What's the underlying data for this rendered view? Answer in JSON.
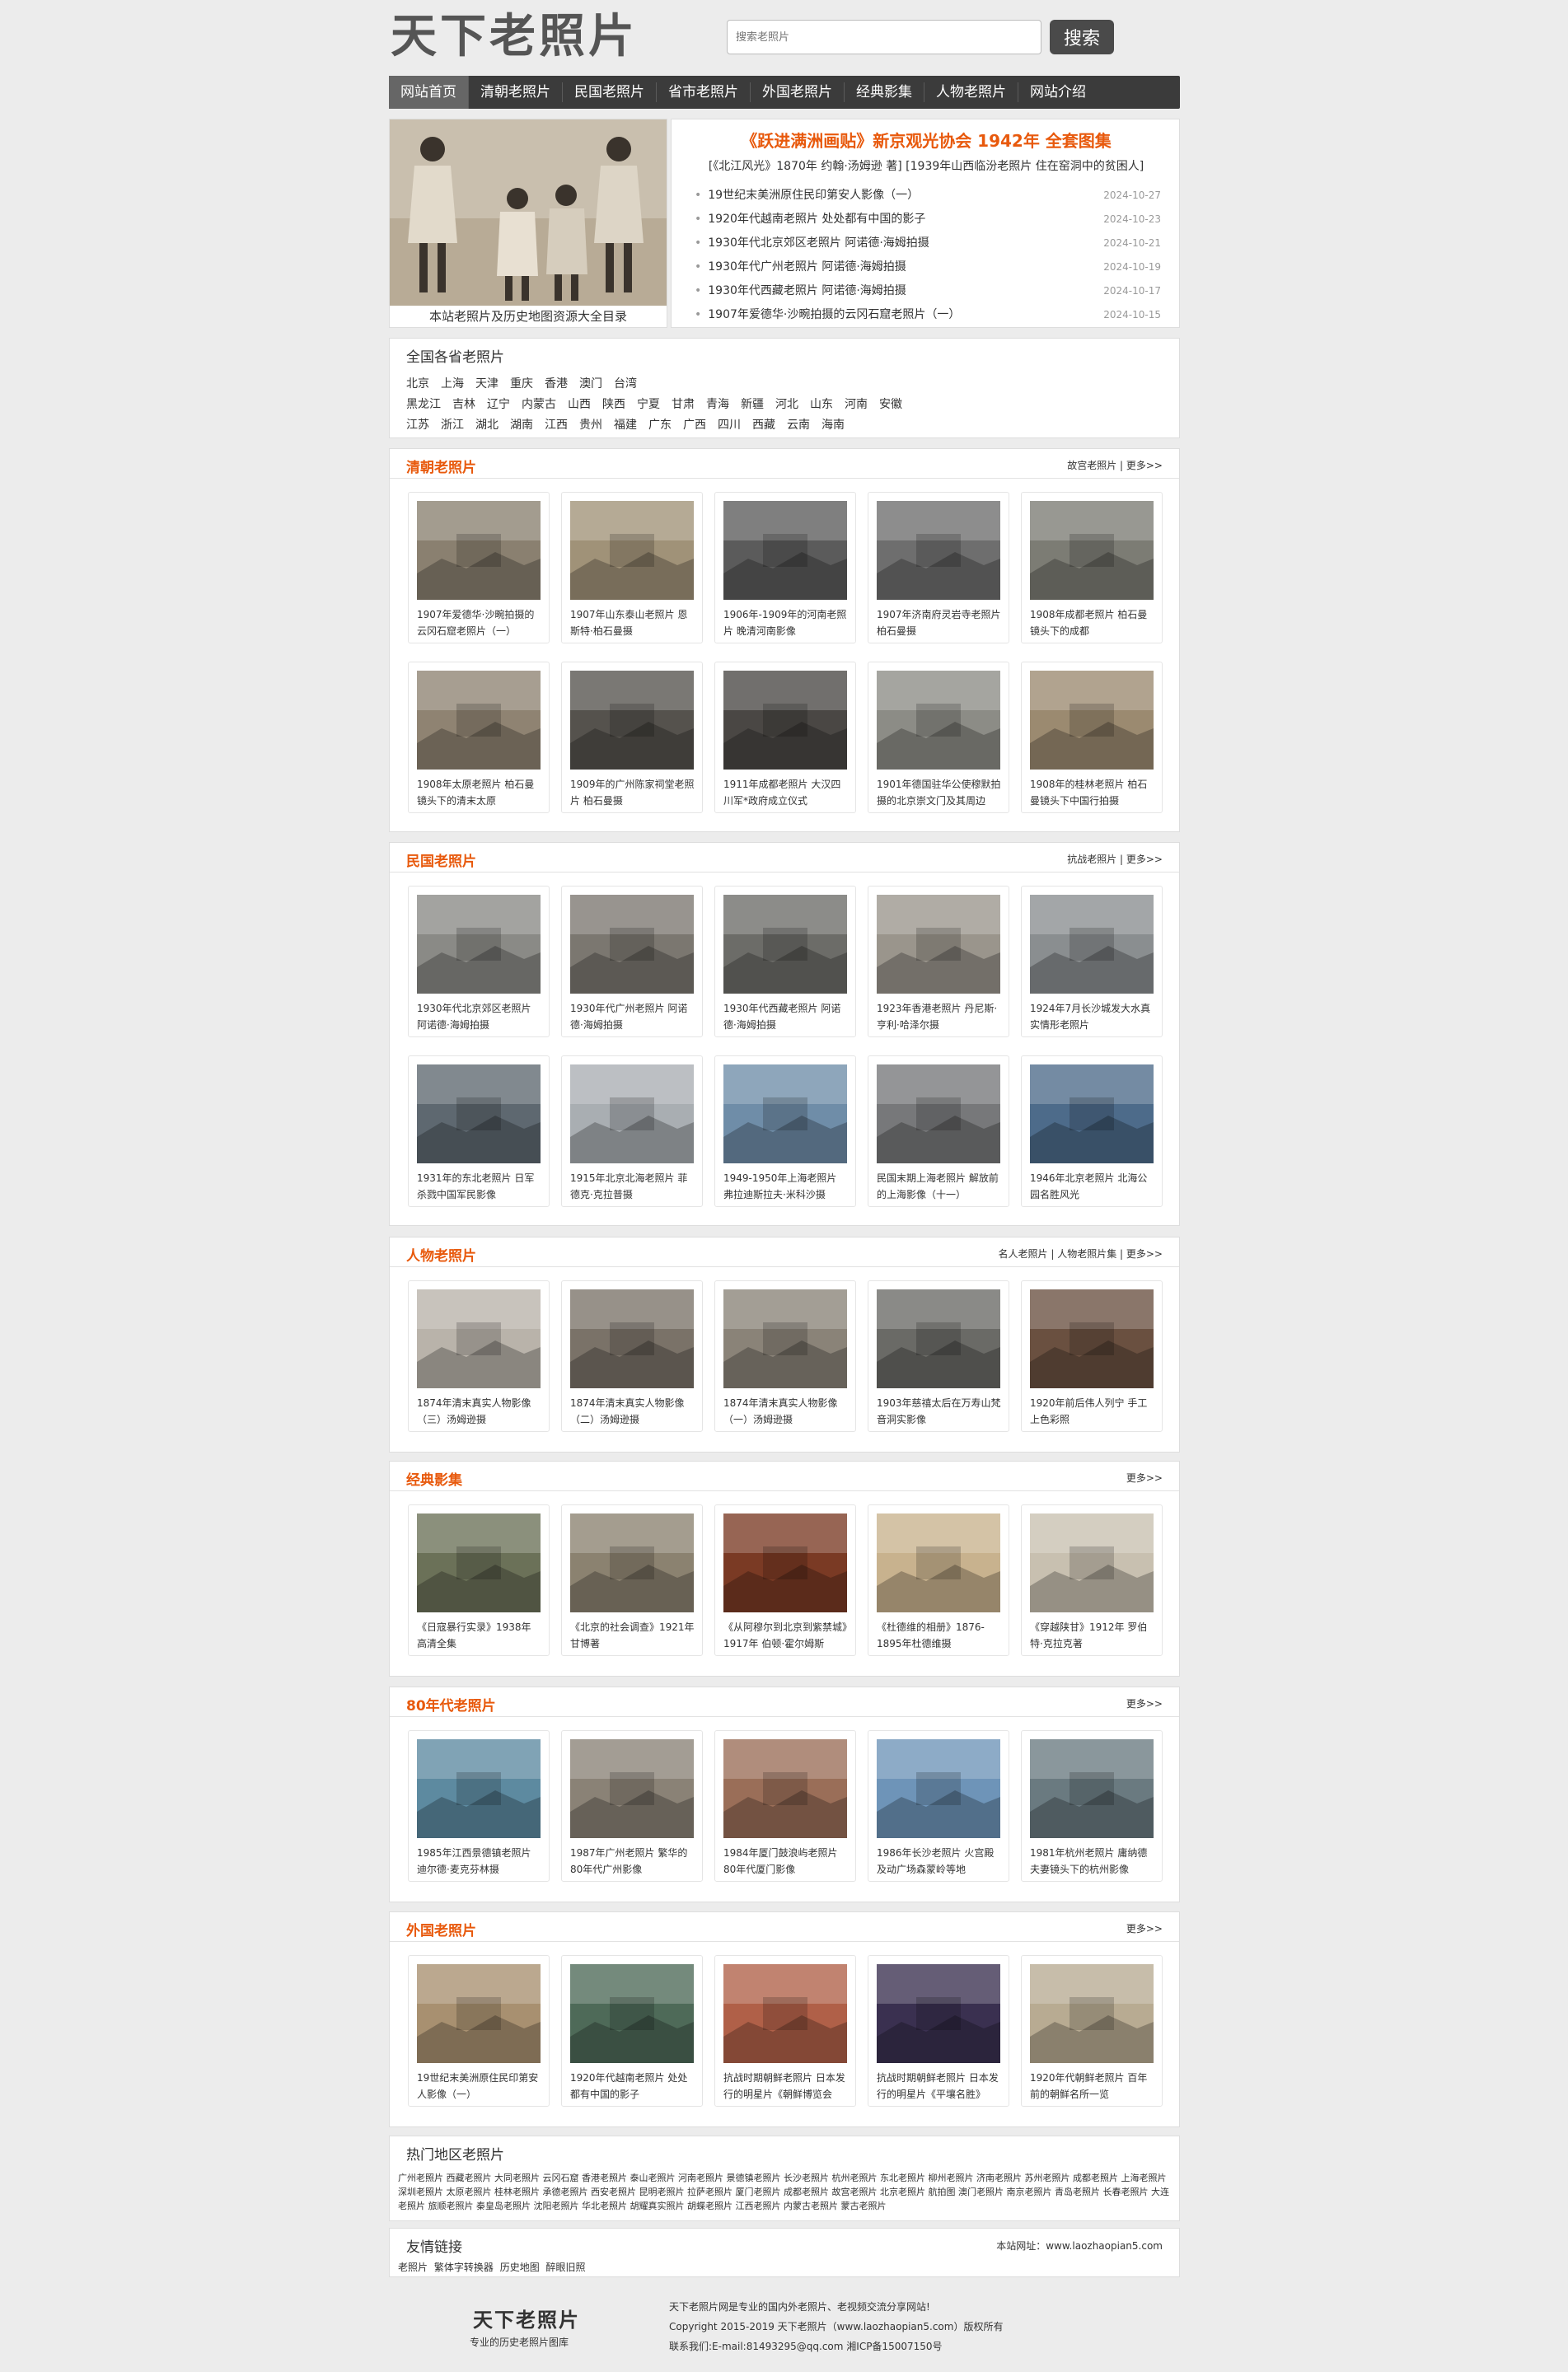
{
  "header": {
    "logo": "天下老照片",
    "search_placeholder": "搜索老照片",
    "search_button": "搜索"
  },
  "nav": [
    "网站首页",
    "清朝老照片",
    "民国老照片",
    "省市老照片",
    "外国老照片",
    "经典影集",
    "人物老照片",
    "网站介绍"
  ],
  "feature": {
    "caption": "本站老照片及历史地图资源大全目录",
    "headline": "《跃进满洲画贴》新京观光协会 1942年 全套图集",
    "subline": "[《北江风光》1870年 约翰·汤姆逊 著] [1939年山西临汾老照片 住在窑洞中的贫困人]",
    "news": [
      {
        "title": "19世纪末美洲原住民印第安人影像（一）",
        "date": "2024-10-27"
      },
      {
        "title": "1920年代越南老照片 处处都有中国的影子",
        "date": "2024-10-23"
      },
      {
        "title": "1930年代北京郊区老照片 阿诺德·海姆拍摄",
        "date": "2024-10-21"
      },
      {
        "title": "1930年代广州老照片 阿诺德·海姆拍摄",
        "date": "2024-10-19"
      },
      {
        "title": "1930年代西藏老照片 阿诺德·海姆拍摄",
        "date": "2024-10-17"
      },
      {
        "title": "1907年爱德华·沙畹拍摄的云冈石窟老照片（一）",
        "date": "2024-10-15"
      }
    ]
  },
  "provinces": {
    "title": "全国各省老照片",
    "line1": [
      "北京",
      "上海",
      "天津",
      "重庆",
      "香港",
      "澳门",
      "台湾"
    ],
    "line2": [
      "黑龙江",
      "吉林",
      "辽宁",
      "内蒙古",
      "山西",
      "陕西",
      "宁夏",
      "甘肃",
      "青海",
      "新疆",
      "河北",
      "山东",
      "河南",
      "安徽"
    ],
    "line3": [
      "江苏",
      "浙江",
      "湖北",
      "湖南",
      "江西",
      "贵州",
      "福建",
      "广东",
      "广西",
      "四川",
      "西藏",
      "云南",
      "海南"
    ]
  },
  "sections": [
    {
      "title": "清朝老照片",
      "more": "故宫老照片 | 更多>>",
      "cards": [
        {
          "caption": "1907年爱德华·沙畹拍摄的云冈石窟老照片（一）",
          "tone": "#8a8070"
        },
        {
          "caption": "1907年山东泰山老照片 恩斯特·柏石曼摄",
          "tone": "#a09278"
        },
        {
          "caption": "1906年-1909年的河南老照片 晚清河南影像",
          "tone": "#5b5b5b"
        },
        {
          "caption": "1907年济南府灵岩寺老照片 柏石曼摄",
          "tone": "#6e6e6e"
        },
        {
          "caption": "1908年成都老照片 柏石曼镜头下的成都",
          "tone": "#7c7c74"
        },
        {
          "caption": "1908年太原老照片 柏石曼镜头下的清末太原",
          "tone": "#8f8372"
        },
        {
          "caption": "1909年的广州陈家祠堂老照片 柏石曼摄",
          "tone": "#55524d"
        },
        {
          "caption": "1911年成都老照片 大汉四川军*政府成立仪式",
          "tone": "#4a4744"
        },
        {
          "caption": "1901年德国驻华公使穆默拍摄的北京崇文门及其周边",
          "tone": "#8c8c86"
        },
        {
          "caption": "1908年的桂林老照片 柏石曼镜头下中国行拍摄",
          "tone": "#9b8a70"
        }
      ]
    },
    {
      "title": "民国老照片",
      "more": "抗战老照片 | 更多>>",
      "cards": [
        {
          "caption": "1930年代北京郊区老照片 阿诺德·海姆拍摄",
          "tone": "#8a8a86"
        },
        {
          "caption": "1930年代广州老照片 阿诺德·海姆拍摄",
          "tone": "#7b7770"
        },
        {
          "caption": "1930年代西藏老照片 阿诺德·海姆拍摄",
          "tone": "#6c6c68"
        },
        {
          "caption": "1923年香港老照片 丹尼斯·亨利·哈泽尔摄",
          "tone": "#9a958c"
        },
        {
          "caption": "1924年7月长沙城发大水真实情形老照片",
          "tone": "#8a8e90"
        },
        {
          "caption": "1931年的东北老照片 日军杀戮中国军民影像",
          "tone": "#5e6870"
        },
        {
          "caption": "1915年北京北海老照片 菲德克·克拉普摄",
          "tone": "#a9aeb2"
        },
        {
          "caption": "1949-1950年上海老照片 弗拉迪斯拉夫·米科沙摄",
          "tone": "#6f8da8"
        },
        {
          "caption": "民国末期上海老照片 解放前的上海影像（十一）",
          "tone": "#77787a"
        },
        {
          "caption": "1946年北京老照片 北海公园名胜风光",
          "tone": "#4d6b8a"
        }
      ]
    },
    {
      "title": "人物老照片",
      "more": "名人老照片 | 人物老照片集 | 更多>>",
      "cards": [
        {
          "caption": "1874年清末真实人物影像（三）汤姆逊摄",
          "tone": "#b9b3aa"
        },
        {
          "caption": "1874年清末真实人物影像（二）汤姆逊摄",
          "tone": "#7a7268"
        },
        {
          "caption": "1874年清末真实人物影像（一）汤姆逊摄",
          "tone": "#8a8378"
        },
        {
          "caption": "1903年慈禧太后在万寿山梵音洞实影像",
          "tone": "#6a6a66"
        },
        {
          "caption": "1920年前后伟人列宁 手工上色彩照",
          "tone": "#6a5040"
        }
      ]
    },
    {
      "title": "经典影集",
      "more": "更多>>",
      "cards": [
        {
          "caption": "《日寇暴行实录》1938年 高清全集",
          "tone": "#6b7158"
        },
        {
          "caption": "《北京的社会调查》1921年 甘博著",
          "tone": "#8b8270"
        },
        {
          "caption": "《从阿穆尔到北京到紫禁城》1917年 伯顿·霍尔姆斯",
          "tone": "#7a3a24"
        },
        {
          "caption": "《杜德维的相册》1876-1895年杜德维摄",
          "tone": "#c8b28e"
        },
        {
          "caption": "《穿越陕甘》1912年 罗伯特·克拉克著",
          "tone": "#c8c0b0"
        }
      ]
    },
    {
      "title": "80年代老照片",
      "more": "更多>>",
      "cards": [
        {
          "caption": "1985年江西景德镇老照片 迪尔德·麦克芬林摄",
          "tone": "#5d8aa0"
        },
        {
          "caption": "1987年广州老照片 繁华的80年代广州影像",
          "tone": "#8a8276"
        },
        {
          "caption": "1984年厦门鼓浪屿老照片 80年代厦门影像",
          "tone": "#9a6e58"
        },
        {
          "caption": "1986年长沙老照片 火宫殿及动广场森蒙岭等地",
          "tone": "#6e94b8"
        },
        {
          "caption": "1981年杭州老照片 庸纳德夫妻镜头下的杭州影像",
          "tone": "#6a7a80"
        }
      ]
    },
    {
      "title": "外国老照片",
      "more": "更多>>",
      "cards": [
        {
          "caption": "19世纪末美洲原住民印第安人影像（一）",
          "tone": "#a89070"
        },
        {
          "caption": "1920年代越南老照片 处处都有中国的影子",
          "tone": "#4e6a58"
        },
        {
          "caption": "抗战时期朝鲜老照片 日本发行的明星片《朝鲜博览会",
          "tone": "#b06048"
        },
        {
          "caption": "抗战时期朝鲜老照片 日本发行的明星片《平壤名胜》",
          "tone": "#3a3050"
        },
        {
          "caption": "1920年代朝鲜老照片 百年前的朝鲜名所一览",
          "tone": "#b8ab92"
        }
      ]
    }
  ],
  "hot_regions": {
    "title": "热门地区老照片",
    "text": "广州老照片 西藏老照片 大同老照片 云冈石窟 香港老照片 泰山老照片 河南老照片 景德镇老照片 长沙老照片 杭州老照片 东北老照片 柳州老照片 济南老照片 苏州老照片 成都老照片 上海老照片 深圳老照片 太原老照片 桂林老照片 承德老照片 西安老照片 昆明老照片 拉萨老照片 厦门老照片 成都老照片 故宫老照片 北京老照片 航拍图 澳门老照片 南京老照片 青岛老照片 长春老照片 大连老照片 旅顺老照片 秦皇岛老照片 沈阳老照片 华北老照片 胡耀真实照片 胡蝶老照片 江西老照片 内蒙古老照片 蒙古老照片"
  },
  "links": {
    "title": "友情链接",
    "url": "本站网址：www.laozhaopian5.com",
    "items": [
      "老照片",
      "繁体字转换器",
      "历史地图",
      "醉眼旧照"
    ]
  },
  "footer": {
    "logo": "天下老照片",
    "slogan": "专业的历史老照片图库",
    "line1": "天下老照片网是专业的国内外老照片、老视频交流分享网站!",
    "line2": "Copyright 2015-2019 天下老照片（www.laozhaopian5.com）版权所有",
    "line3": "联系我们:E-mail:81493295@qq.com 湘ICP备15007150号"
  }
}
